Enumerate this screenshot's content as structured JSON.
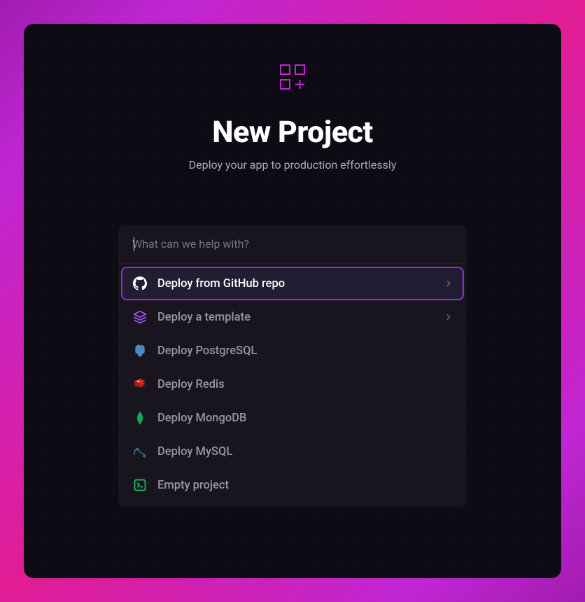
{
  "header": {
    "title": "New Project",
    "subtitle": "Deploy your app to production effortlessly"
  },
  "search": {
    "placeholder": "What can we help with?",
    "value": ""
  },
  "options": [
    {
      "icon": "github",
      "label": "Deploy from GitHub repo",
      "chevron": true,
      "selected": true
    },
    {
      "icon": "layers",
      "label": "Deploy a template",
      "chevron": true,
      "selected": false
    },
    {
      "icon": "postgres",
      "label": "Deploy PostgreSQL",
      "chevron": false,
      "selected": false
    },
    {
      "icon": "redis",
      "label": "Deploy Redis",
      "chevron": false,
      "selected": false
    },
    {
      "icon": "mongodb",
      "label": "Deploy MongoDB",
      "chevron": false,
      "selected": false
    },
    {
      "icon": "mysql",
      "label": "Deploy MySQL",
      "chevron": false,
      "selected": false
    },
    {
      "icon": "empty",
      "label": "Empty project",
      "chevron": false,
      "selected": false
    }
  ]
}
